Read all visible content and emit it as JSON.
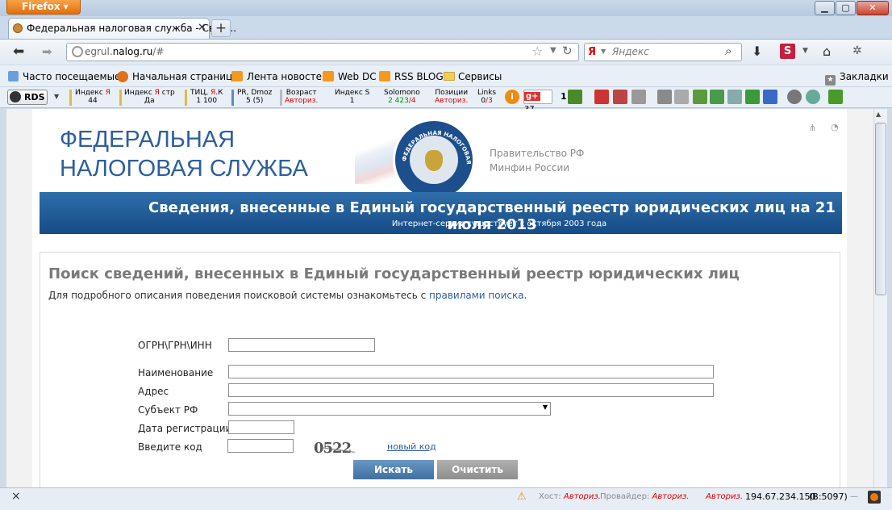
{
  "browser": {
    "app_button": "Firefox",
    "tab_title": "Федеральная налоговая служба - Свед...",
    "new_tab": "+",
    "url_prefix": "egrul.",
    "url_domain": "nalog.ru",
    "url_suffix": "/#",
    "search_placeholder": "Яндекс",
    "bookmarks": [
      {
        "label": "Часто посещаемые",
        "icon": "frequent-icon"
      },
      {
        "label": "Начальная страница",
        "icon": "firefox-icon"
      },
      {
        "label": "Лента новостей",
        "icon": "rss-icon"
      },
      {
        "label": "Web DC",
        "icon": "rss-icon"
      },
      {
        "label": "RSS BLOG",
        "icon": "rss-icon"
      },
      {
        "label": "Сервисы",
        "icon": "folder-icon"
      }
    ],
    "bookmarks_menu": "Закладки"
  },
  "rds": {
    "label": "RDS",
    "items": [
      {
        "l1": "Индекс Я",
        "l2": "44"
      },
      {
        "l1": "Индекс Я стр",
        "l2": "Да"
      },
      {
        "l1": "ТИЦ, Я.К",
        "l2": "1 100"
      },
      {
        "l1": "PR, Dmoz",
        "l2": "5 (5)"
      },
      {
        "l1": "Возраст",
        "l2": "Авториз."
      },
      {
        "l1": "Индекс S",
        "l2": "1"
      },
      {
        "l1": "Solomono",
        "l2a": "2 423",
        "l2b": "/4"
      },
      {
        "l1": "Позиции",
        "l2": "Авториз."
      },
      {
        "l1": "Links",
        "l2a": "0",
        "l2b": "/3"
      }
    ],
    "gplus_count": "37",
    "counter": "1"
  },
  "page": {
    "header_line1": "ФЕДЕРАЛЬНАЯ",
    "header_line2": "НАЛОГОВАЯ СЛУЖБА",
    "emblem_text": "ФЕДЕРАЛЬНАЯ НАЛОГОВАЯ СЛУЖБА",
    "gov_link": "Правительство РФ",
    "minfin_link": "Минфин России",
    "banner_title": "Сведения, внесенные в Единый государственный реестр юридических лиц на 21 июля 2013",
    "banner_subtitle": "Интернет-сервис существует с октября 2003 года",
    "form_title": "Поиск сведений, внесенных в Единый государственный реестр юридических лиц",
    "form_desc_prefix": "Для подробного описания поведения поисковой системы ознакомьтесь с ",
    "form_desc_link": "правилами поиска",
    "form_desc_suffix": ".",
    "fields": {
      "ogrn_label": "ОГРН\\ГРН\\ИНН",
      "name_label": "Наименование",
      "address_label": "Адрес",
      "region_label": "Субъект РФ",
      "regdate_label": "Дата регистрации",
      "code_label": "Введите код"
    },
    "captcha_text": "0522",
    "new_code": "новый код",
    "search_button": "Искать",
    "clear_button": "Очистить"
  },
  "status": {
    "close": "×",
    "host_label": "Хост:",
    "host_value": "Авториз.",
    "provider_label": "Провайдер:",
    "provider_value": "Авториз.",
    "auth": "Авториз.",
    "ip": "194.67.234.150",
    "b_count": "(B:5097)",
    "sep": "—"
  },
  "colors": {
    "accent_blue": "#2c5f9e",
    "banner": "#1d5a99",
    "button_blue": "#4f7fb0",
    "button_gray": "#9a9a9a",
    "firefox_orange": "#e8780f"
  }
}
